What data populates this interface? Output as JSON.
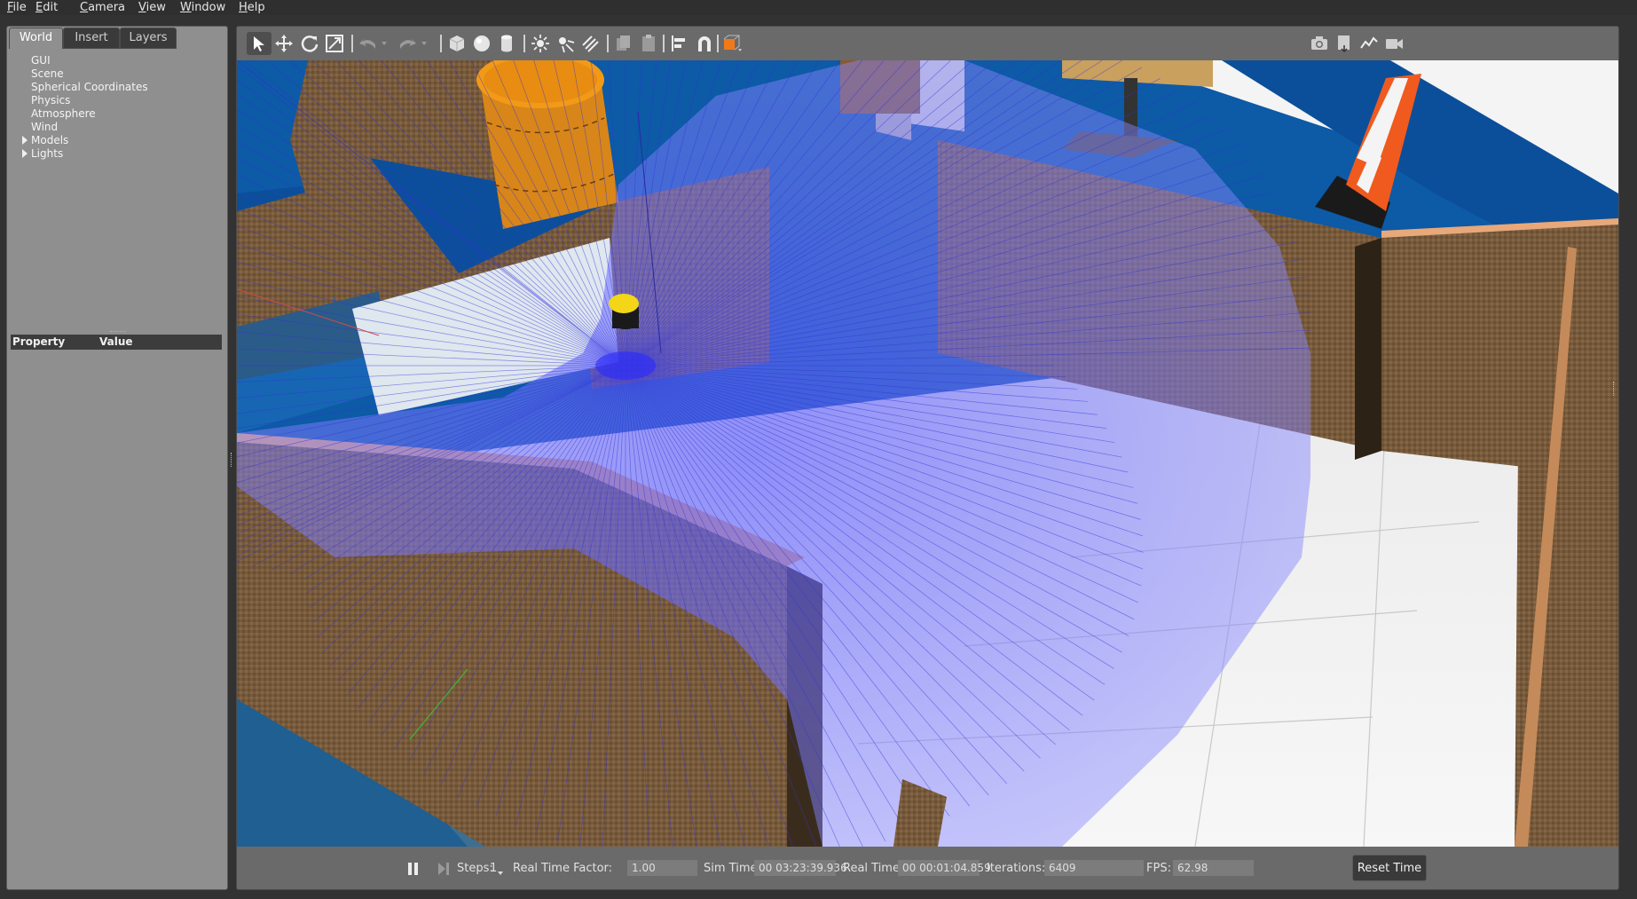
{
  "menu": [
    "File",
    "Edit",
    "Camera",
    "View",
    "Window",
    "Help"
  ],
  "tabs": [
    "World",
    "Insert",
    "Layers"
  ],
  "world_tree": {
    "items": [
      "GUI",
      "Scene",
      "Spherical Coordinates",
      "Physics",
      "Atmosphere",
      "Wind"
    ],
    "expandable": [
      "Models",
      "Lights"
    ]
  },
  "property_table": {
    "col_property": "Property",
    "col_value": "Value"
  },
  "toolbar_icons": [
    "select-mode-icon",
    "translate-mode-icon",
    "rotate-mode-icon",
    "scale-mode-icon",
    "undo-icon",
    "redo-icon",
    "box-shape-icon",
    "sphere-shape-icon",
    "cylinder-shape-icon",
    "point-light-icon",
    "spot-light-icon",
    "directional-light-icon",
    "copy-icon",
    "paste-icon",
    "align-icon",
    "snap-icon",
    "view-angle-icon",
    "screenshot-icon",
    "log-icon",
    "plot-icon",
    "video-record-icon"
  ],
  "bottom": {
    "steps_label": "Steps:",
    "steps_value": "1",
    "rtf_label": "Real Time Factor:",
    "rtf_value": "1.00",
    "sim_label": "Sim Time:",
    "sim_value": "00 03:23:39.936",
    "real_label": "Real Time:",
    "real_value": "00 00:01:04.859",
    "iter_label": "Iterations:",
    "iter_value": "6409",
    "fps_label": "FPS:",
    "fps_value": "62.98",
    "reset_label": "Reset Time"
  },
  "colors": {
    "panel_bg": "#8f8f8f",
    "toolbar_bg": "#6a6a6a",
    "laser": "#6a6aff",
    "wall": "#7a5a3a",
    "floor": "#f2f2f2",
    "water": "#0a5fb8"
  }
}
